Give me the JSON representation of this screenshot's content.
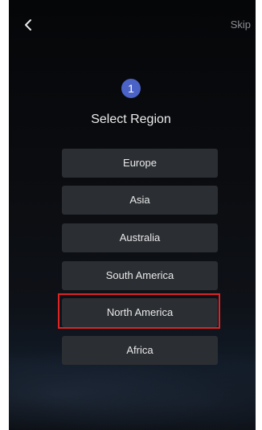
{
  "header": {
    "back_icon": "chevron-left-icon",
    "skip_label": "Skip"
  },
  "step": {
    "number": "1"
  },
  "title": "Select Region",
  "regions": [
    {
      "label": "Europe"
    },
    {
      "label": "Asia"
    },
    {
      "label": "Australia"
    },
    {
      "label": "South America"
    },
    {
      "label": "North America"
    },
    {
      "label": "Africa"
    }
  ],
  "highlighted_region": "North America",
  "colors": {
    "accent": "#4b63c6",
    "button_bg": "#2b2e33",
    "highlight": "#e02323"
  }
}
